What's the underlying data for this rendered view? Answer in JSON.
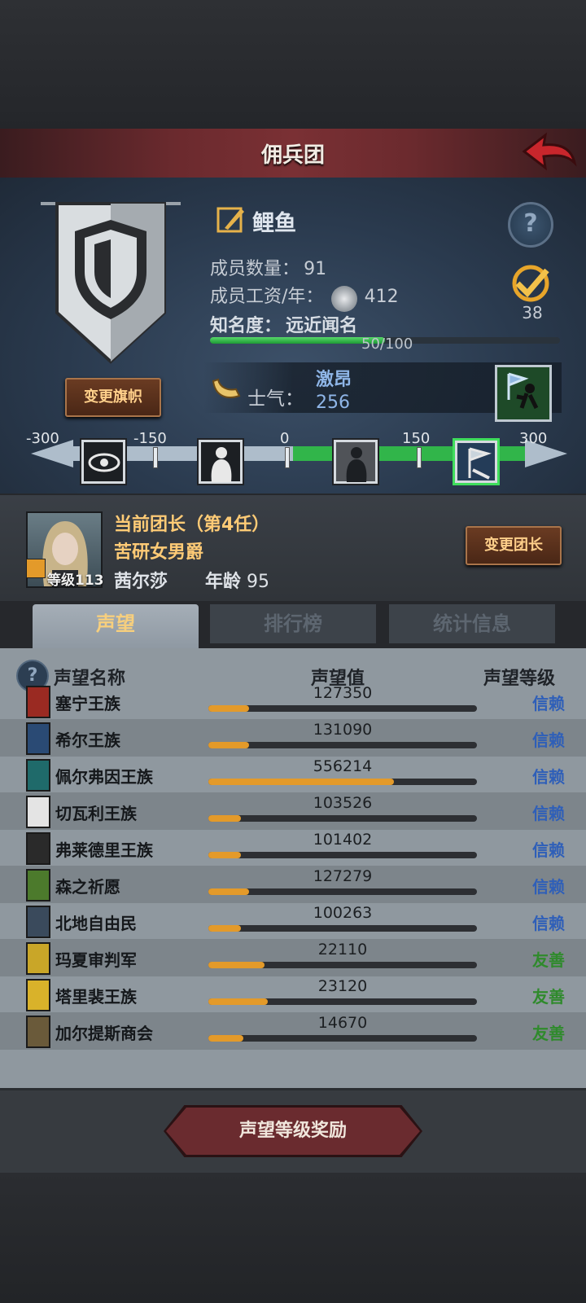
{
  "header": {
    "title": "佣兵团"
  },
  "guild": {
    "name": "鲤鱼",
    "change_banner_label": "变更旗帜",
    "members_label": "成员数量：",
    "members_value": "91",
    "salary_label": "成员工资/年：",
    "salary_value": "412",
    "fame_label": "知名度：",
    "fame_value": "远近闻名",
    "fame_progress_text": "50/100",
    "fame_progress": 0.5,
    "medal_count": "38"
  },
  "morale": {
    "label": "士气：",
    "state": "激昂",
    "value": "256",
    "scale_ticks": [
      "-300",
      "-150",
      "0",
      "150",
      "300"
    ],
    "tiers": [
      "unrest-eye-icon",
      "despair-figure-icon",
      "calm-figure-icon",
      "charge-banner-icon"
    ]
  },
  "commander": {
    "title": "当前团长（第4任）",
    "trait": "苦研女男爵",
    "level_label": "等级113",
    "name": "茜尔莎",
    "age_label": "年龄",
    "age_value": "95",
    "change_label": "变更团长"
  },
  "tabs": [
    "声望",
    "排行榜",
    "统计信息"
  ],
  "reputation": {
    "headers": {
      "name": "声望名称",
      "value": "声望值",
      "level": "声望等级"
    },
    "rows": [
      {
        "name": "塞宁王族",
        "value": "127350",
        "fill": 0.15,
        "level": "信赖",
        "color": "#9a2a22"
      },
      {
        "name": "希尔王族",
        "value": "131090",
        "fill": 0.15,
        "level": "信赖",
        "color": "#2a4a74"
      },
      {
        "name": "佩尔弗因王族",
        "value": "556214",
        "fill": 0.69,
        "level": "信赖",
        "color": "#1f6a6a"
      },
      {
        "name": "切瓦利王族",
        "value": "103526",
        "fill": 0.12,
        "level": "信赖",
        "color": "#e4e4e4"
      },
      {
        "name": "弗莱德里王族",
        "value": "101402",
        "fill": 0.12,
        "level": "信赖",
        "color": "#2a2a2a"
      },
      {
        "name": "森之祈愿",
        "value": "127279",
        "fill": 0.15,
        "level": "信赖",
        "color": "#4c7a2c"
      },
      {
        "name": "北地自由民",
        "value": "100263",
        "fill": 0.12,
        "level": "信赖",
        "color": "#3a4a5c"
      },
      {
        "name": "玛夏审判军",
        "value": "22110",
        "fill": 0.21,
        "level": "友善",
        "color": "#c9a628"
      },
      {
        "name": "塔里裴王族",
        "value": "23120",
        "fill": 0.22,
        "level": "友善",
        "color": "#d9b22a"
      },
      {
        "name": "加尔提斯商会",
        "value": "14670",
        "fill": 0.13,
        "level": "友善",
        "color": "#6a5a3a"
      }
    ],
    "level_colors": {
      "信赖": "#2f5fb8",
      "友善": "#2f8a2c"
    }
  },
  "reward_button": "声望等级奖励"
}
